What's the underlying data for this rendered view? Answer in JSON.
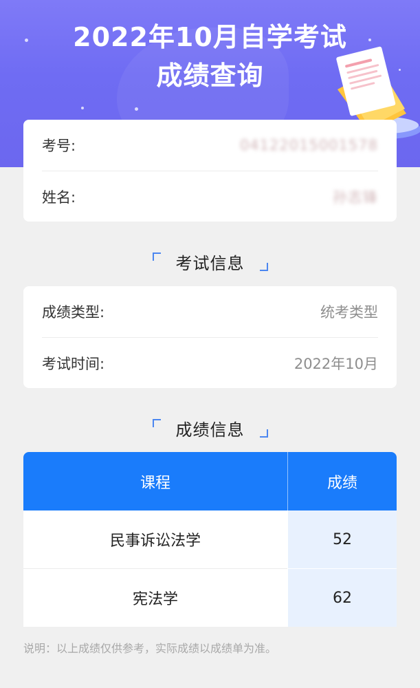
{
  "header": {
    "title_line1": "2022年10月自学考试",
    "title_line2": "成绩查询"
  },
  "candidate": {
    "exam_no_label": "考号:",
    "exam_no_value": "04122015001578",
    "name_label": "姓名:",
    "name_value": "孙志锋"
  },
  "exam_section": {
    "title": "考试信息",
    "type_label": "成绩类型:",
    "type_value": "统考类型",
    "time_label": "考试时间:",
    "time_value": "2022年10月"
  },
  "score_section": {
    "title": "成绩信息",
    "col_course": "课程",
    "col_score": "成绩",
    "rows": [
      {
        "course": "民事诉讼法学",
        "score": "52"
      },
      {
        "course": "宪法学",
        "score": "62"
      }
    ]
  },
  "footer": {
    "note": "说明：以上成绩仅供参考，实际成绩以成绩单为准。"
  },
  "colors": {
    "hero": "#7470f3",
    "table_header": "#1a7cfb",
    "score_cell": "#e8f1fe",
    "bracket": "#4b86f0"
  },
  "icons": {
    "hero_decoration": "document-stack-illustration"
  }
}
